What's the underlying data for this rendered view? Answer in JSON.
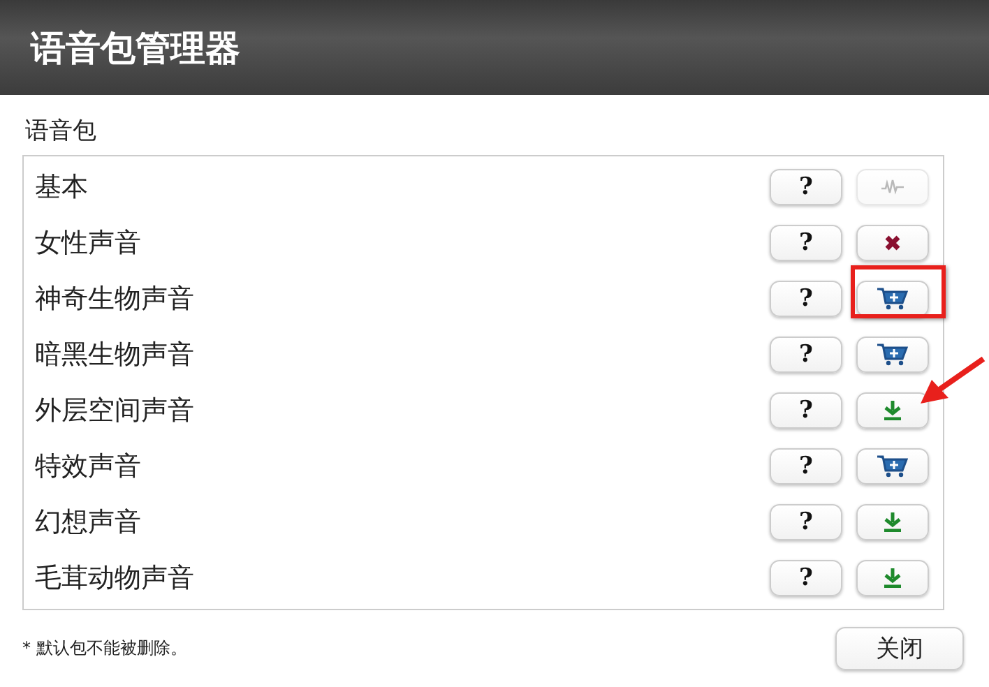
{
  "window": {
    "title": "语音包管理器"
  },
  "list_label": "语音包",
  "packs": [
    {
      "name": "基本",
      "help": "?",
      "kind": "waveform",
      "disabled": true,
      "highlighted": false,
      "pointed_at": false
    },
    {
      "name": "女性声音",
      "help": "?",
      "kind": "delete",
      "disabled": false,
      "highlighted": false,
      "pointed_at": false
    },
    {
      "name": "神奇生物声音",
      "help": "?",
      "kind": "cart",
      "disabled": false,
      "highlighted": true,
      "pointed_at": false
    },
    {
      "name": "暗黑生物声音",
      "help": "?",
      "kind": "cart",
      "disabled": false,
      "highlighted": false,
      "pointed_at": false
    },
    {
      "name": "外层空间声音",
      "help": "?",
      "kind": "download",
      "disabled": false,
      "highlighted": false,
      "pointed_at": true
    },
    {
      "name": "特效声音",
      "help": "?",
      "kind": "cart",
      "disabled": false,
      "highlighted": false,
      "pointed_at": false
    },
    {
      "name": "幻想声音",
      "help": "?",
      "kind": "download",
      "disabled": false,
      "highlighted": false,
      "pointed_at": false
    },
    {
      "name": "毛茸动物声音",
      "help": "?",
      "kind": "download",
      "disabled": false,
      "highlighted": false,
      "pointed_at": false
    }
  ],
  "footnote": "* 默认包不能被删除。",
  "close_button": "关闭"
}
